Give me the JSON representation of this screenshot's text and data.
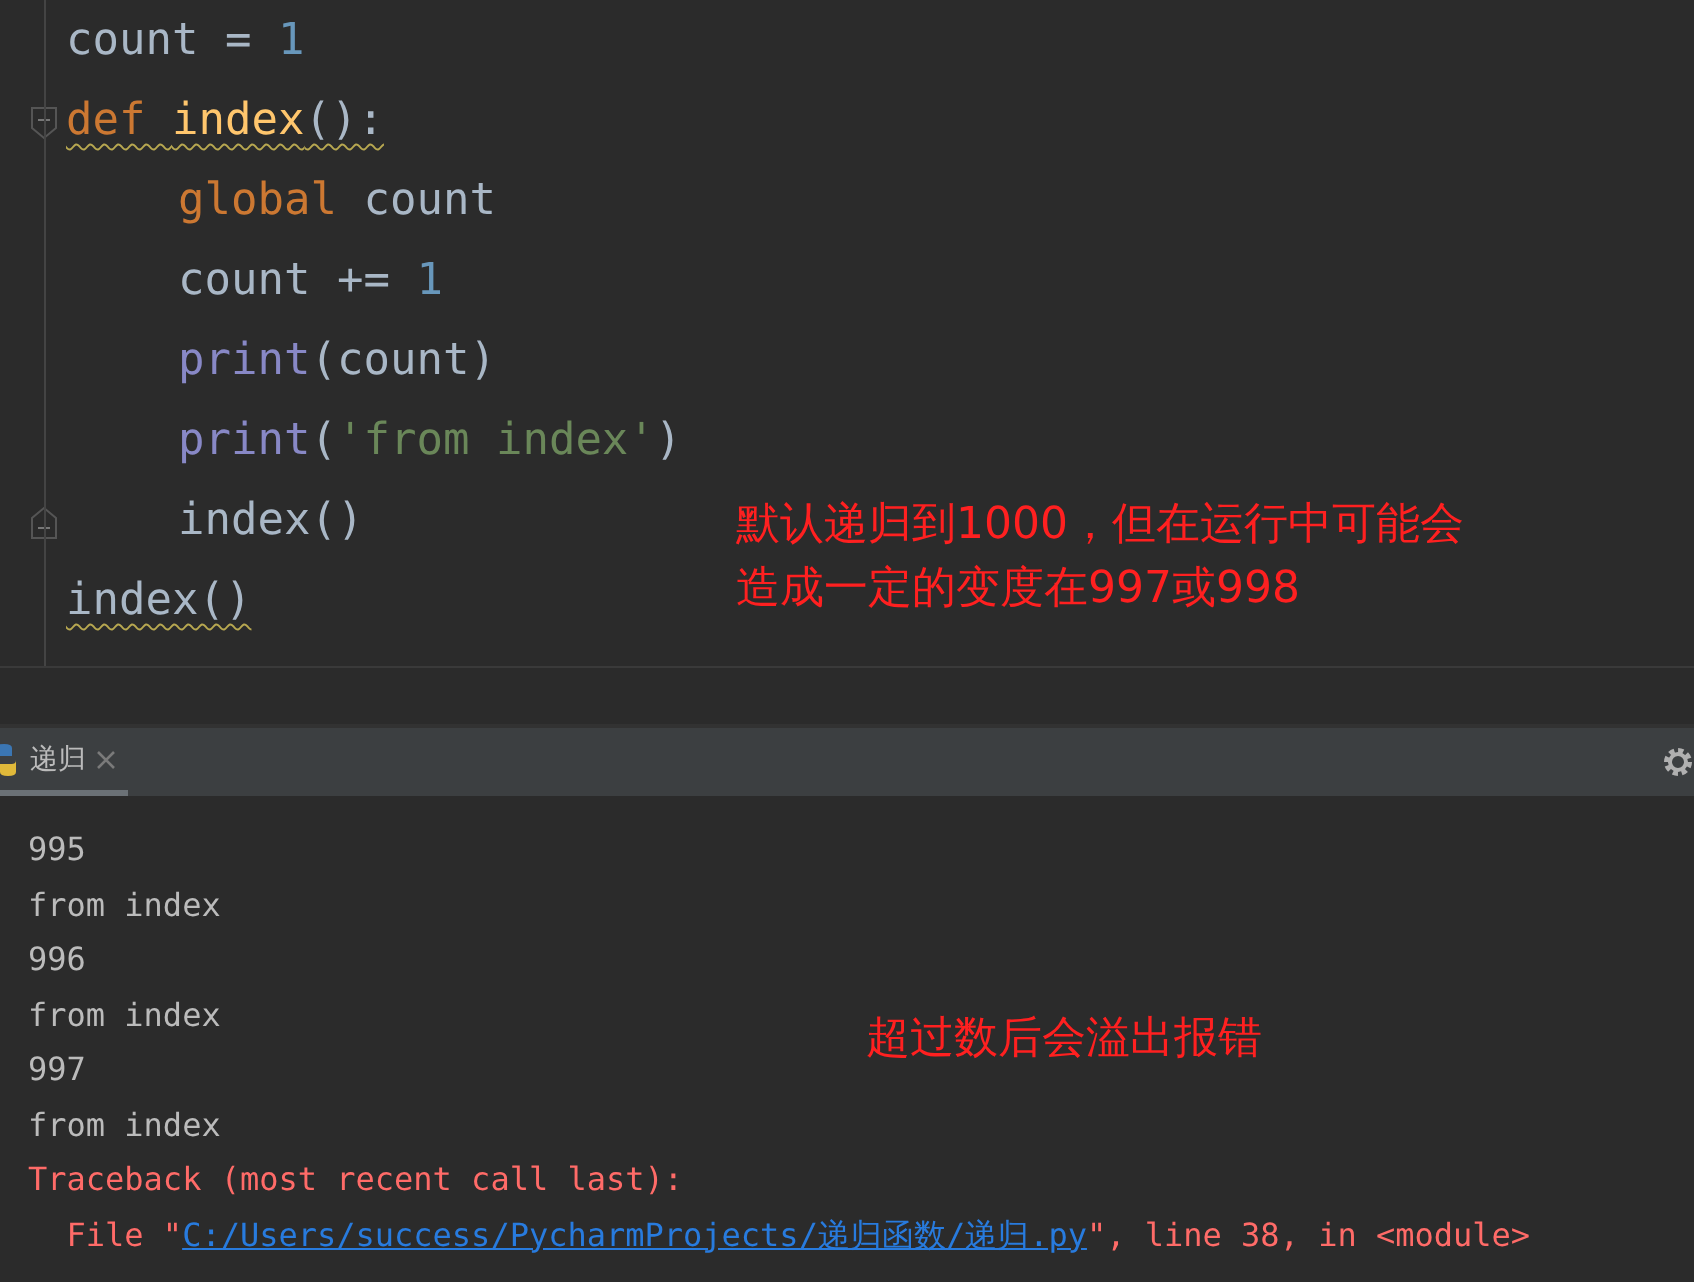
{
  "editor": {
    "lines": [
      {
        "warning": false,
        "tokens": [
          {
            "kind": "name",
            "text": "count = "
          },
          {
            "kind": "number",
            "text": "1"
          }
        ]
      },
      {
        "warning": true,
        "expanded": true,
        "tokens": [
          {
            "kind": "keyword",
            "text": "def "
          },
          {
            "kind": "function",
            "text": "index"
          },
          {
            "kind": "name",
            "text": "():"
          }
        ],
        "children": [
          {
            "warning": false,
            "tokens": [
              {
                "kind": "keyword",
                "text": "global "
              },
              {
                "kind": "name",
                "text": "count"
              }
            ]
          },
          {
            "warning": false,
            "tokens": [
              {
                "kind": "name",
                "text": "count += "
              },
              {
                "kind": "number",
                "text": "1"
              }
            ]
          },
          {
            "warning": false,
            "tokens": [
              {
                "kind": "builtin",
                "text": "print"
              },
              {
                "kind": "name",
                "text": "(count)"
              }
            ]
          },
          {
            "warning": false,
            "tokens": [
              {
                "kind": "builtin",
                "text": "print"
              },
              {
                "kind": "name",
                "text": "("
              },
              {
                "kind": "string",
                "text": "'from index'"
              },
              {
                "kind": "name",
                "text": ")"
              }
            ]
          },
          {
            "warning": false,
            "tokens": [
              {
                "kind": "name",
                "text": "index()"
              }
            ]
          }
        ]
      },
      {
        "warning": true,
        "tokens": [
          {
            "kind": "name",
            "text": "index()"
          }
        ]
      }
    ],
    "annotation": [
      "默认递归到1000，但在运行中可能会",
      "造成一定的变度在997或998"
    ]
  },
  "run_tab": {
    "label": "递归",
    "selected": true
  },
  "output": {
    "lines": [
      {
        "kind": "plain",
        "text": "995"
      },
      {
        "kind": "plain",
        "text": "from index"
      },
      {
        "kind": "plain",
        "text": "996"
      },
      {
        "kind": "plain",
        "text": "from index"
      },
      {
        "kind": "plain",
        "text": "997"
      },
      {
        "kind": "plain",
        "text": "from index"
      },
      {
        "kind": "error",
        "text": "Traceback (most recent call last):"
      },
      {
        "kind": "file",
        "prefix": "  File \"",
        "link": "C:/Users/success/PycharmProjects/递归函数/递归.py",
        "suffix": "\", line 38, in <module>"
      }
    ],
    "annotation": "超过数后会溢出报错"
  }
}
